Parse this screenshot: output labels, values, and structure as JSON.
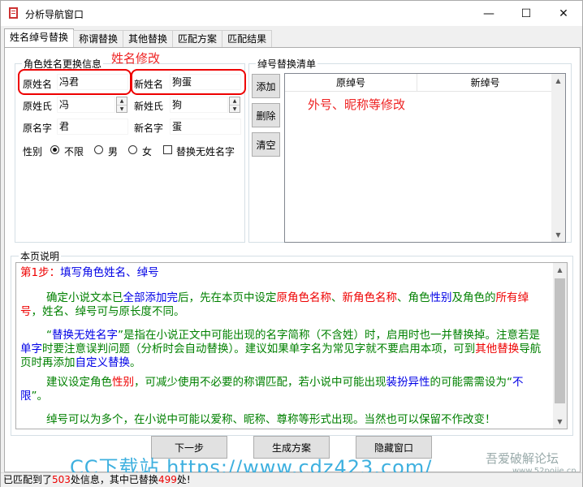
{
  "window": {
    "title": "分析导航窗口",
    "controls": {
      "minimize": "—",
      "maximize": "☐",
      "close": "✕"
    }
  },
  "tabs": [
    {
      "label": "姓名绰号替换",
      "active": true
    },
    {
      "label": "称谓替换",
      "active": false
    },
    {
      "label": "其他替换",
      "active": false
    },
    {
      "label": "匹配方案",
      "active": false
    },
    {
      "label": "匹配结果",
      "active": false
    }
  ],
  "role_group": {
    "legend": "角色姓名更换信息",
    "annotation": "姓名修改",
    "orig_fullname_label": "原姓名",
    "orig_fullname_value": "冯君",
    "new_fullname_label": "新姓名",
    "new_fullname_value": "狗蛋",
    "orig_surname_label": "原姓氏",
    "orig_surname_value": "冯",
    "new_surname_label": "新姓氏",
    "new_surname_value": "狗",
    "orig_givenname_label": "原名字",
    "orig_givenname_value": "君",
    "new_givenname_label": "新名字",
    "new_givenname_value": "蛋",
    "gender_label": "性别",
    "gender_options": [
      "不限",
      "男",
      "女"
    ],
    "gender_selected": "不限",
    "replace_no_surname_label": "替换无姓名字",
    "replace_no_surname_checked": false
  },
  "nickname_group": {
    "legend": "绰号替换清单",
    "annotation": "外号、昵称等修改",
    "add_button": "添加",
    "delete_button": "删除",
    "clear_button": "清空",
    "columns": [
      "原绰号",
      "新绰号"
    ]
  },
  "description": {
    "legend": "本页说明",
    "step": {
      "prefix": "第1步：",
      "text": "填写角色姓名、绰号"
    },
    "para1": [
      {
        "t": "确定小说文本已",
        "c": "green"
      },
      {
        "t": "全部添加完",
        "c": "blue"
      },
      {
        "t": "后，先在本页中设定",
        "c": "green"
      },
      {
        "t": "原角色名称",
        "c": "red"
      },
      {
        "t": "、",
        "c": "green"
      },
      {
        "t": "新角色名称",
        "c": "red"
      },
      {
        "t": "、角色",
        "c": "green"
      },
      {
        "t": "性别",
        "c": "blue"
      },
      {
        "t": "及角色的",
        "c": "green"
      },
      {
        "t": "所有绰号",
        "c": "red"
      },
      {
        "t": "，姓名、绰号可与原长度不同。",
        "c": "green"
      }
    ],
    "para2": [
      {
        "t": "“",
        "c": "green"
      },
      {
        "t": "替换无姓名字",
        "c": "blue"
      },
      {
        "t": "”是指在小说正文中可能出现的名字简称（不含姓）时，启用时也一并替换掉。注意若是",
        "c": "green"
      },
      {
        "t": "单字",
        "c": "blue"
      },
      {
        "t": "时要注意误判问题（分析时会自动替换）。建议如果单字名为常见字就不要启用本项，可到",
        "c": "green"
      },
      {
        "t": "其他替换",
        "c": "red"
      },
      {
        "t": "导航页时再添加",
        "c": "green"
      },
      {
        "t": "自定义替换",
        "c": "blue"
      },
      {
        "t": "。",
        "c": "green"
      }
    ],
    "para3": [
      {
        "t": "建议设定角色",
        "c": "green"
      },
      {
        "t": "性别",
        "c": "red"
      },
      {
        "t": "，可减少使用不必要的称谓匹配，若小说中可能出现",
        "c": "green"
      },
      {
        "t": "装扮异性",
        "c": "blue"
      },
      {
        "t": "的可能需需设为“",
        "c": "green"
      },
      {
        "t": "不限",
        "c": "blue"
      },
      {
        "t": "”。",
        "c": "green"
      }
    ],
    "para4": [
      {
        "t": "绰号可以为多个，在小说中可能以爱称、昵称、尊称等形式出现。当然也可以保留不作改变！",
        "c": "green"
      }
    ]
  },
  "buttons": {
    "next_step": "下一步",
    "generate_plan": "生成方案",
    "hide_window": "隐藏窗口"
  },
  "status": {
    "prefix": "已匹配到了",
    "matched": "503",
    "middle": "处信息，其中已替换",
    "replaced": "499",
    "suffix": "处!"
  },
  "watermarks": {
    "main": "CC下载站 https://www.cdz423.com/",
    "forum": "吾爱破解论坛",
    "forum_url": "www.52pojie.cn"
  },
  "colors": {
    "annotation_red": "#ee2222",
    "accent_blue": "#0000e6",
    "text_green": "#008000"
  }
}
